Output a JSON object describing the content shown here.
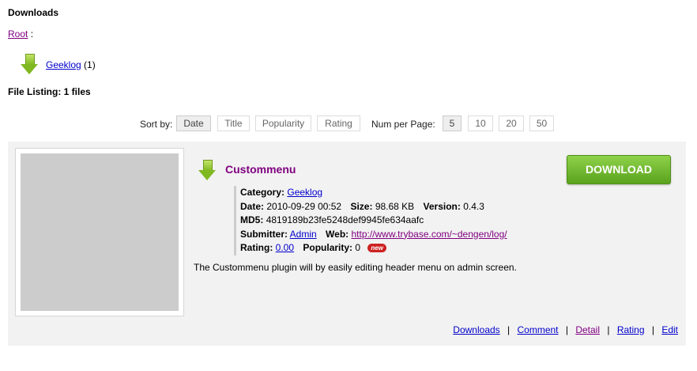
{
  "header": {
    "title": "Downloads"
  },
  "breadcrumb": {
    "root": "Root",
    "sep": ":"
  },
  "category": {
    "name": "Geeklog",
    "count": "(1)"
  },
  "listing": {
    "title": "File Listing: 1 files"
  },
  "sort": {
    "label": "Sort by:",
    "options": [
      "Date",
      "Title",
      "Popularity",
      "Rating"
    ],
    "active": "Date"
  },
  "per_page": {
    "label": "Num per Page:",
    "options": [
      "5",
      "10",
      "20",
      "50"
    ],
    "active": "5"
  },
  "file": {
    "title": "Custommenu",
    "download_label": "DOWNLOAD",
    "category_label": "Category:",
    "category_value": "Geeklog",
    "date_label": "Date:",
    "date_value": "2010-09-29 00:52",
    "size_label": "Size:",
    "size_value": "98.68 KB",
    "version_label": "Version:",
    "version_value": "0.4.3",
    "md5_label": "MD5:",
    "md5_value": "4819189b23fe5248def9945fe634aafc",
    "submitter_label": "Submitter:",
    "submitter_value": "Admin",
    "web_label": "Web:",
    "web_value": "http://www.trybase.com/~dengen/log/",
    "rating_label": "Rating:",
    "rating_value": "0.00",
    "popularity_label": "Popularity:",
    "popularity_value": "0",
    "new_badge": "new",
    "description": "The Custommenu plugin will by easily editing header menu on admin screen."
  },
  "footer_links": {
    "downloads": "Downloads",
    "comment": "Comment",
    "detail": "Detail",
    "rating": "Rating",
    "edit": "Edit",
    "sep": "|"
  },
  "colors": {
    "download_button": "#5aa21d",
    "title": "#800080",
    "link": "#0000cc",
    "panel_bg": "#f2f2f2"
  }
}
